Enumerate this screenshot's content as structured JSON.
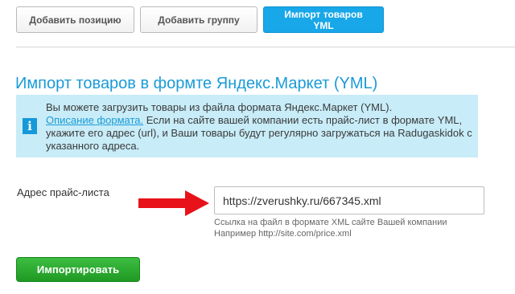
{
  "tabs": [
    {
      "label": "Добавить позицию",
      "active": false
    },
    {
      "label": "Добавить группу",
      "active": false
    },
    {
      "label": "Импорт товаров YML",
      "active": true
    }
  ],
  "heading": "Импорт товаров в формте Яндекс.Маркет (YML)",
  "info": {
    "icon": "info-icon",
    "line1": "Вы можете загрузить товары из файла формата Яндекс.Маркет (YML).",
    "link": "Описание формата.",
    "rest": " Если на сайте вашей компании есть прайс-лист в формате YML, укажите его адрес (url), и Ваши товары будут регулярно загружаться на Radugaskidok с указанного адреса."
  },
  "form": {
    "label": "Адрес прайс-листа",
    "value": "https://zverushky.ru/667345.xml",
    "hint_line1": "Ссылка на файл в формате XML сайте Вашей компании",
    "hint_line2": "Например http://site.com/price.xml",
    "submit": "Импортировать"
  },
  "colors": {
    "accent": "#18a7e8",
    "heading": "#1a9bd7",
    "info_bg": "#c8ecf8",
    "arrow": "#e8121a",
    "submit": "#2aa82f"
  }
}
